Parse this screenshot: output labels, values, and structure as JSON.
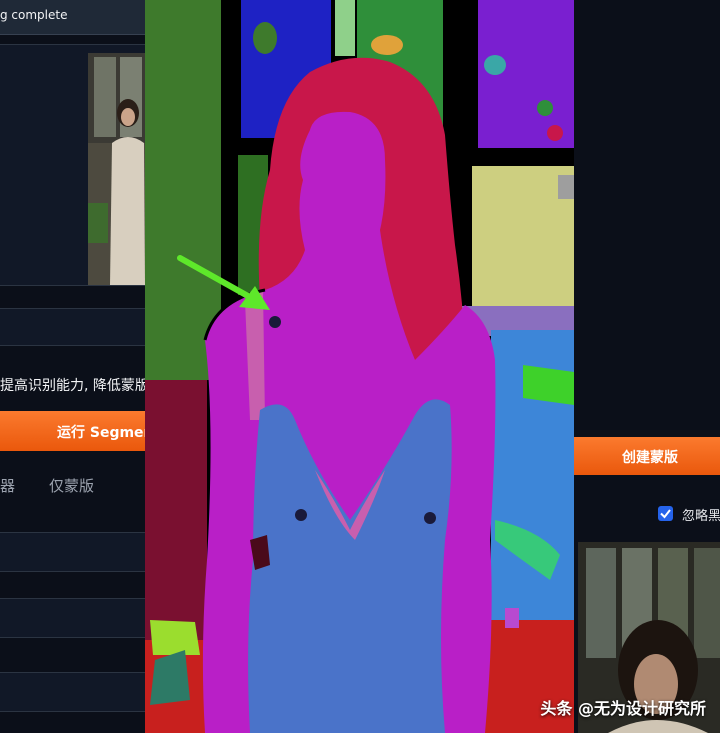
{
  "left_panel": {
    "status_text": "g complete",
    "note_text": "提高识别能力, 降低蒙版",
    "run_button_label": "运行 Segmen",
    "tab_1_label": "器",
    "tab_2_label": "仅蒙版"
  },
  "right_panel": {
    "create_mask_button_label": "创建蒙版",
    "checkbox_label": "忽略黑"
  },
  "watermark": {
    "platform": "头条",
    "author": "@无为设计研究所"
  },
  "colors": {
    "accent_orange": "#ea580c",
    "checkbox_blue": "#2563eb",
    "arrow_green": "#5ee82a",
    "hair_red": "#c8174a",
    "skin_magenta": "#b91fc7",
    "dress_blue": "#4a73c9"
  },
  "icons": {
    "checkbox": "checkmark-icon",
    "annotation": "green-arrow-icon"
  }
}
